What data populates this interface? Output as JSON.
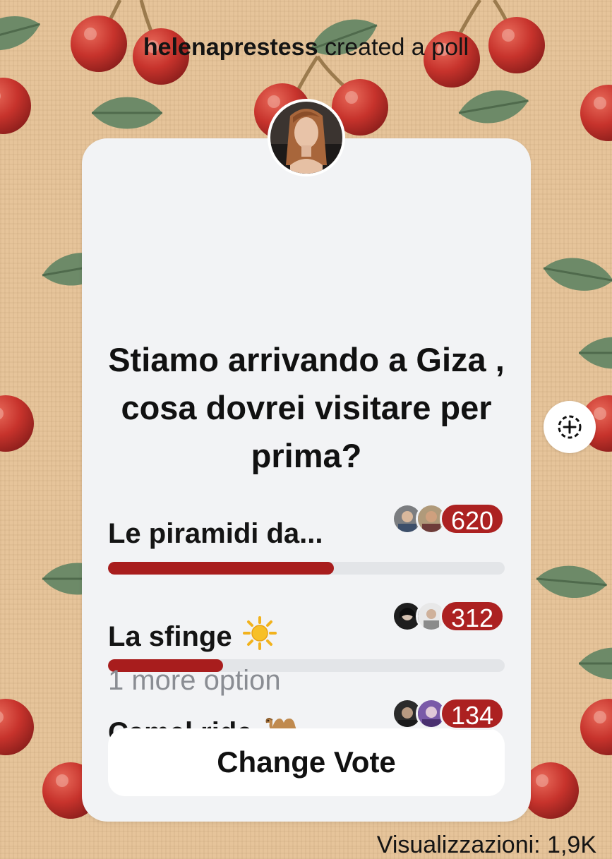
{
  "header": {
    "username": "helenaprestess",
    "action_text": "created a poll"
  },
  "poll": {
    "question": "Stiamo arrivando a Giza , cosa dovrei visitare per prima?",
    "options": [
      {
        "label": "Le piramidi da...",
        "emoji": "",
        "votes": "620",
        "fill_percent": 57
      },
      {
        "label": "La sfinge",
        "emoji": "sun",
        "votes": "312",
        "fill_percent": 29
      },
      {
        "label": "Camel ride",
        "emoji": "camel",
        "votes": "134",
        "fill_percent": 12
      }
    ],
    "more_options": "1 more option",
    "change_vote_label": "Change Vote"
  },
  "footer": {
    "views_text": "Visualizzazioni: 1,9K"
  },
  "colors": {
    "accent": "#ac2121",
    "bar_fill": "#a81d1d",
    "card": "#f2f3f5",
    "track": "#e3e5e8",
    "muted_text": "#8a8d93"
  },
  "icons": [
    "add-reaction-icon",
    "sun-emoji-icon",
    "camel-emoji-icon"
  ]
}
